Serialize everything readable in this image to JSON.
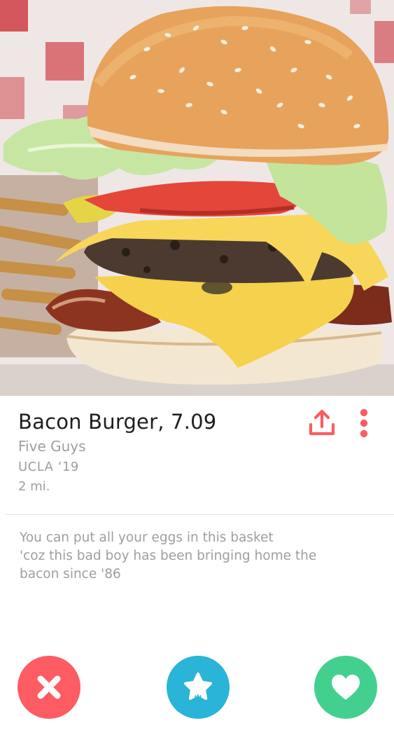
{
  "profile": {
    "title": "Bacon Burger, 7.09",
    "line1": "Five Guys",
    "line2": "UCLA ‘19",
    "line3": "2 mi."
  },
  "bio": {
    "lines": [
      "You can put all your eggs in this basket",
      "'coz this bad boy has been bringing home the",
      "bacon since '86"
    ]
  },
  "icons": {
    "share": "share-upload-icon",
    "more": "vertical-dots-icon",
    "nope": "close-x-icon",
    "superlike": "star-icon",
    "like": "heart-icon"
  },
  "colors": {
    "accent": "#fd5c63",
    "nope": "#fd5c63",
    "superlike": "#2ab4d7",
    "like": "#43d08f"
  }
}
